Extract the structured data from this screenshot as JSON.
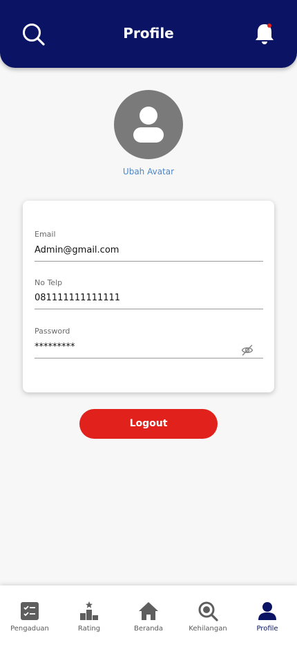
{
  "header": {
    "title": "Profile",
    "search_icon": "search-icon",
    "notification_icon": "bell-icon",
    "notification_dot_color": "#e0211c",
    "background": "#0b1464"
  },
  "avatar": {
    "icon": "user-icon",
    "change_label": "Ubah Avatar"
  },
  "form": {
    "email": {
      "label": "Email",
      "value": "Admin@gmail.com"
    },
    "phone": {
      "label": "No Telp",
      "value": "081111111111111"
    },
    "password": {
      "label": "Password",
      "value": "*********",
      "toggle_icon": "eye-off-icon"
    }
  },
  "logout": {
    "label": "Logout",
    "color": "#e0211c"
  },
  "bottom_nav": {
    "active": "Profile",
    "items": [
      {
        "label": "Pengaduan",
        "icon": "checklist-icon"
      },
      {
        "label": "Rating",
        "icon": "podium-icon"
      },
      {
        "label": "Beranda",
        "icon": "home-icon"
      },
      {
        "label": "Kehilangan",
        "icon": "search-icon"
      },
      {
        "label": "Profile",
        "icon": "user-icon"
      }
    ]
  }
}
